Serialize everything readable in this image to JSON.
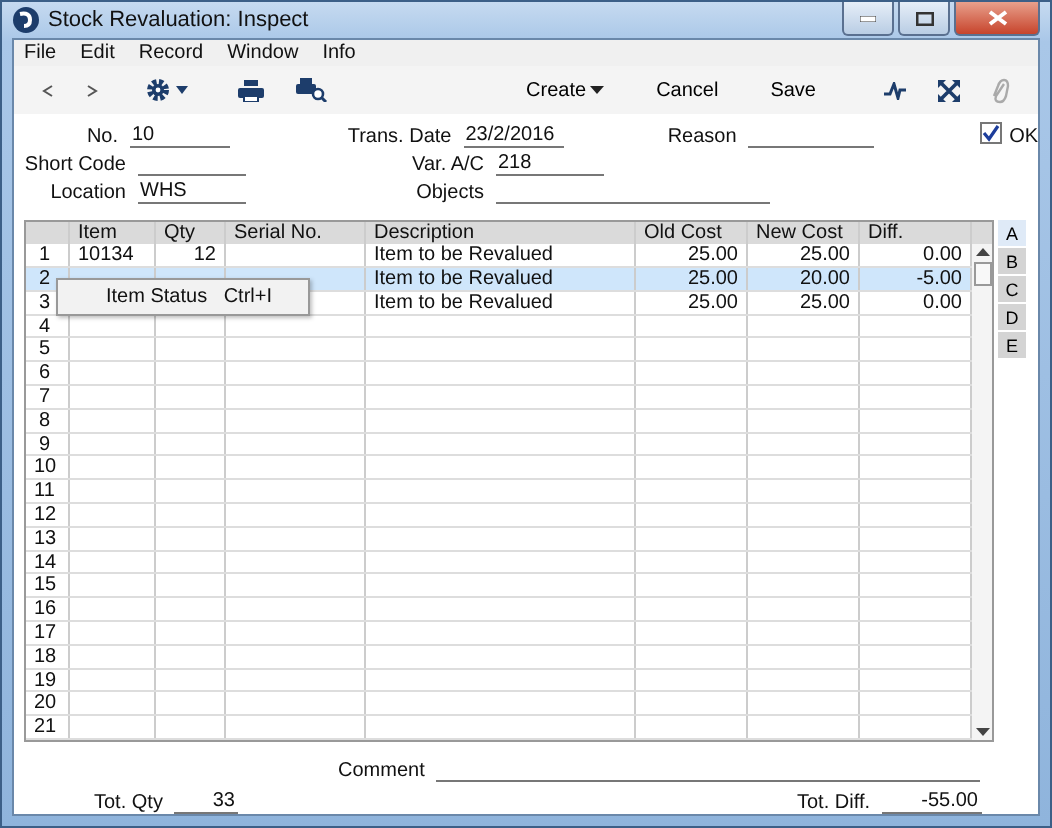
{
  "window": {
    "title": "Stock Revaluation: Inspect"
  },
  "menu": [
    "File",
    "Edit",
    "Record",
    "Window",
    "Info"
  ],
  "toolbar": {
    "buttons": [
      "Create",
      "Cancel",
      "Save"
    ]
  },
  "form": {
    "no": {
      "label": "No.",
      "value": "10"
    },
    "trans_date": {
      "label": "Trans. Date",
      "value": "23/2/2016"
    },
    "reason": {
      "label": "Reason"
    },
    "ok": {
      "label": "OK",
      "checked": true
    },
    "short_code": {
      "label": "Short Code"
    },
    "var_ac": {
      "label": "Var. A/C",
      "value": "218"
    },
    "location": {
      "label": "Location",
      "value": "WHS"
    },
    "objects": {
      "label": "Objects"
    }
  },
  "table": {
    "columns": [
      "Item",
      "Qty",
      "Serial No.",
      "Description",
      "Old Cost",
      "New Cost",
      "Diff."
    ],
    "rows": [
      {
        "number": "1",
        "item": "10134",
        "qty": "12",
        "description": "Item to be Revalued",
        "old_cost": "25.00",
        "new_cost": "25.00",
        "diff": "0.00",
        "selected": false
      },
      {
        "number": "2",
        "description": "Item to be Revalued",
        "old_cost": "25.00",
        "new_cost": "20.00",
        "diff": "-5.00",
        "selected": true
      },
      {
        "number": "3",
        "description": "Item to be Revalued",
        "old_cost": "25.00",
        "new_cost": "25.00",
        "diff": "0.00",
        "selected": false
      },
      {
        "number": "4",
        "selected": false
      },
      {
        "number": "5",
        "selected": false
      },
      {
        "number": "6",
        "selected": false
      },
      {
        "number": "7",
        "selected": false
      },
      {
        "number": "8",
        "selected": false
      },
      {
        "number": "9",
        "selected": false
      },
      {
        "number": "10",
        "selected": false
      },
      {
        "number": "11",
        "selected": false
      },
      {
        "number": "12",
        "selected": false
      },
      {
        "number": "13",
        "selected": false
      },
      {
        "number": "14",
        "selected": false
      },
      {
        "number": "15",
        "selected": false
      },
      {
        "number": "16",
        "selected": false
      },
      {
        "number": "17",
        "selected": false
      },
      {
        "number": "18",
        "selected": false
      },
      {
        "number": "19",
        "selected": false
      },
      {
        "number": "20",
        "selected": false
      },
      {
        "number": "21",
        "selected": false
      }
    ]
  },
  "side_tabs": [
    {
      "label": "A",
      "selected": true
    },
    {
      "label": "B",
      "selected": false
    },
    {
      "label": "C",
      "selected": false
    },
    {
      "label": "D",
      "selected": false
    },
    {
      "label": "E",
      "selected": false
    }
  ],
  "context_menu": {
    "items": [
      {
        "label": "Item Status",
        "shortcut": "Ctrl+I"
      }
    ]
  },
  "footer": {
    "comment": {
      "label": "Comment"
    },
    "tot_qty": {
      "label": "Tot. Qty",
      "value": "33"
    },
    "tot_diff": {
      "label": "Tot. Diff.",
      "value": "-55.00"
    }
  }
}
